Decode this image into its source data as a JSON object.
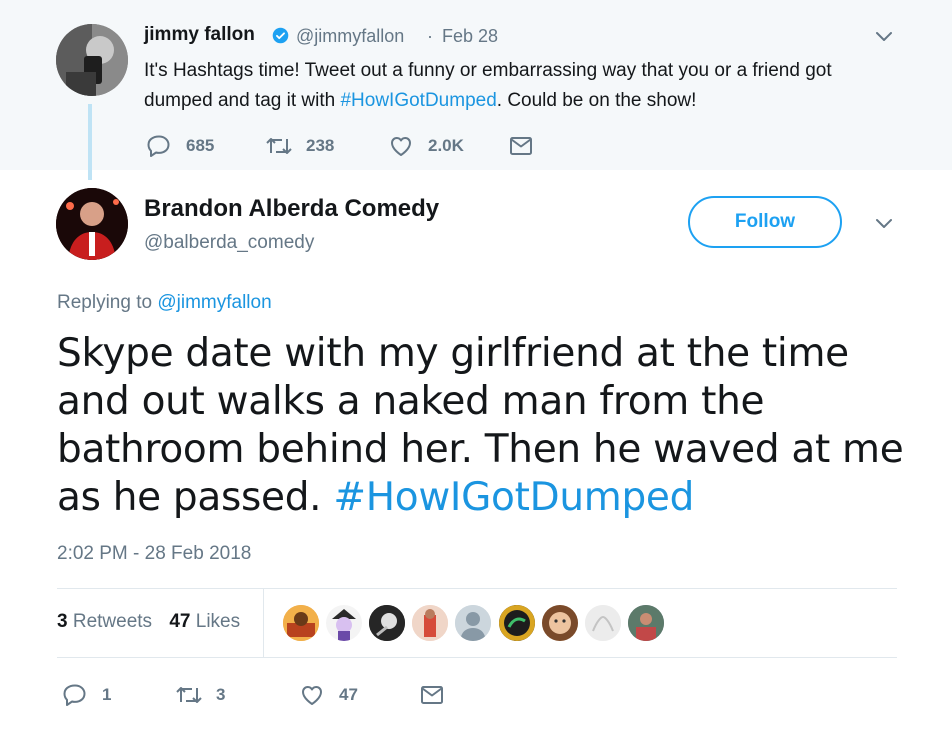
{
  "original_tweet": {
    "author_name": "jimmy fallon",
    "handle": "@jimmyfallon",
    "separator": "·",
    "date": "Feb 28",
    "text_parts": [
      "It's Hashtags time! Tweet out a funny or embarrassing way that you or a friend got dumped and tag it with ",
      "#HowIGotDumped",
      ". Could be on the show!"
    ],
    "actions": {
      "replies": "685",
      "retweets": "238",
      "likes": "2.0K"
    }
  },
  "reply_tweet": {
    "author_name": "Brandon Alberda Comedy",
    "handle": "@balberda_comedy",
    "follow_label": "Follow",
    "replying_prefix": "Replying to ",
    "replying_to": "@jimmyfallon",
    "text_main": "Skype date with my girlfriend at the time and out walks a naked man from the bathroom behind her. Then he waved at me as he passed. ",
    "text_hashtag": "#HowIGotDumped",
    "timestamp": "2:02 PM - 28 Feb 2018",
    "retweets_count": "3",
    "retweets_label": "Retweets",
    "likes_count": "47",
    "likes_label": "Likes",
    "actions": {
      "replies": "1",
      "retweets": "3",
      "likes": "47"
    }
  },
  "colors": {
    "accent": "#1da1f2",
    "link": "#1b95e0",
    "muted": "#657786",
    "top_background": "#f5f8fa"
  },
  "icons": {
    "reply": "speech-bubble-icon",
    "retweet": "retweet-arrows-icon",
    "like": "heart-icon",
    "dm": "envelope-icon",
    "more": "chevron-down-icon",
    "verified": "verified-badge-icon"
  }
}
